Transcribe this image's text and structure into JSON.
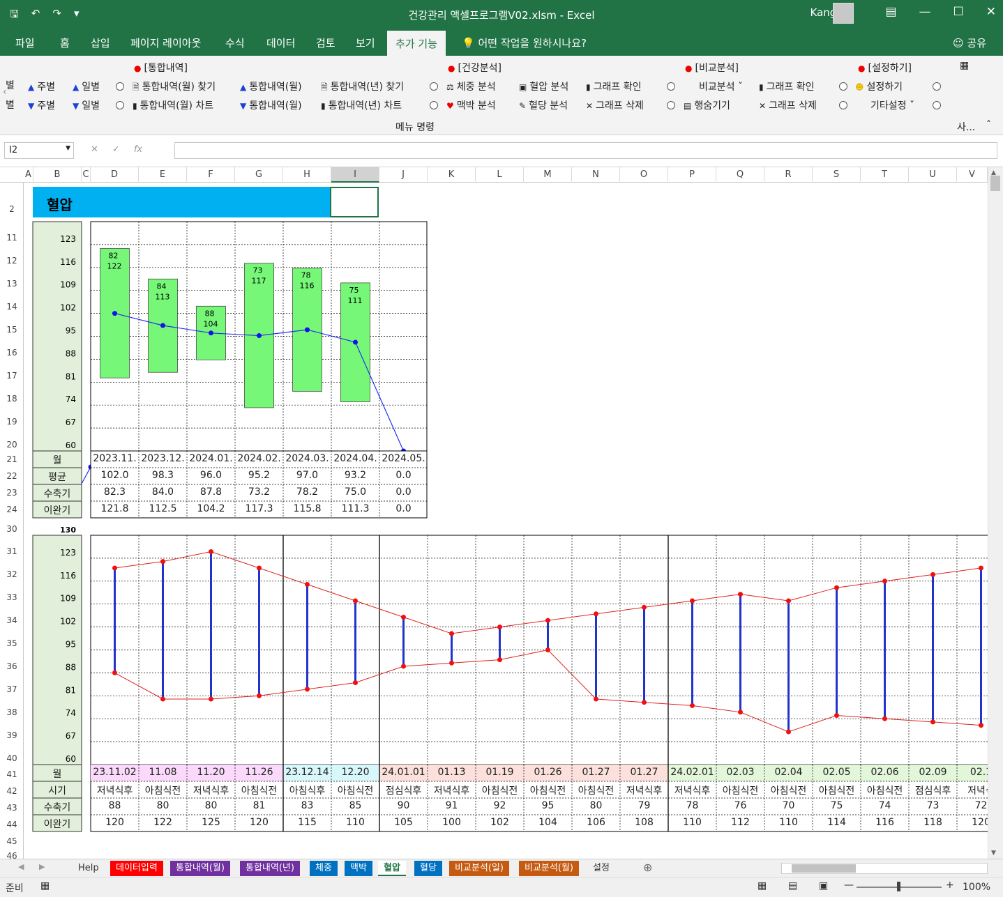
{
  "titlebar": {
    "title": "건강관리 액셀프로그램V02.xlsm  -  Excel",
    "user": "Kangha"
  },
  "tabs": [
    "파일",
    "홈",
    "삽입",
    "페이지 레이아웃",
    "수식",
    "데이터",
    "검토",
    "보기",
    "추가 기능"
  ],
  "tellme": "어떤 작업을 원하시나요?",
  "share": "공유",
  "ribbon": {
    "groups": {
      "integrated": "[통합내역]",
      "health": "[건강분석]",
      "compare": "[비교분석]",
      "settings": "[설정하기]"
    },
    "weekly": "주별",
    "daily": "일별",
    "find_month": "통합내역(월) 찾기",
    "chart_month": "통합내역(월) 차트",
    "int_month": "통합내역(월)",
    "find_year": "통합내역(년) 찾기",
    "chart_year": "통합내역(년) 차트",
    "weight": "체중 분석",
    "pulse": "맥박 분석",
    "bp": "혈압 분석",
    "sugar": "혈당 분석",
    "graph_check": "그래프 확인",
    "graph_delete": "그래프 삭제",
    "compare": "비교분석",
    "hide_rows": "행숨기기",
    "setup": "설정하기",
    "other_setup": "기타설정",
    "menu_cmd": "메뉴 명령",
    "more": "사..."
  },
  "namebox": "I2",
  "columns": [
    "A",
    "B",
    "C",
    "D",
    "E",
    "F",
    "G",
    "H",
    "I",
    "J",
    "K",
    "L",
    "M",
    "N",
    "O",
    "P",
    "Q",
    "R",
    "S",
    "T",
    "U",
    "V"
  ],
  "rows": {
    "r2": "2",
    "upper": [
      "11",
      "12",
      "13",
      "14",
      "15",
      "16",
      "17",
      "18",
      "19",
      "20",
      "21",
      "22",
      "23",
      "24"
    ],
    "lower": [
      "30",
      "31",
      "32",
      "33",
      "34",
      "35",
      "36",
      "37",
      "38",
      "39",
      "40",
      "41",
      "42",
      "43",
      "44",
      "45",
      "46"
    ]
  },
  "banner": "혈압",
  "upper": {
    "yticks": [
      "123",
      "116",
      "109",
      "102",
      "95",
      "88",
      "81",
      "74",
      "67",
      "60"
    ],
    "row_labels": [
      "월",
      "평균",
      "수축기",
      "이완기"
    ],
    "months": [
      "2023.11.",
      "2023.12.",
      "2024.01.",
      "2024.02.",
      "2024.03.",
      "2024.04.",
      "2024.05."
    ],
    "avg": [
      "102.0",
      "98.3",
      "96.0",
      "95.2",
      "97.0",
      "93.2",
      "0.0"
    ],
    "sys": [
      "82.3",
      "84.0",
      "87.8",
      "73.2",
      "78.2",
      "75.0",
      "0.0"
    ],
    "dia": [
      "121.8",
      "112.5",
      "104.2",
      "117.3",
      "115.8",
      "111.3",
      "0.0"
    ],
    "bar_labels": [
      [
        "82",
        "122"
      ],
      [
        "84",
        "113"
      ],
      [
        "88",
        "104"
      ],
      [
        "73",
        "117"
      ],
      [
        "78",
        "116"
      ],
      [
        "75",
        "111"
      ]
    ]
  },
  "lower": {
    "ytop": "130",
    "yticks": [
      "123",
      "116",
      "109",
      "102",
      "95",
      "88",
      "81",
      "74",
      "67",
      "60"
    ],
    "row_labels": [
      "월",
      "시기",
      "수축기",
      "이완기"
    ],
    "dates": [
      "23.11.02",
      "11.08",
      "11.20",
      "11.26",
      "23.12.14",
      "12.20",
      "24.01.01",
      "01.13",
      "01.19",
      "01.26",
      "01.27",
      "01.27",
      "24.02.01",
      "02.03",
      "02.04",
      "02.05",
      "02.06",
      "02.09",
      "02.1"
    ],
    "times": [
      "저녁식후",
      "아침식전",
      "저녁식후",
      "아침식전",
      "아침식후",
      "아침식전",
      "점심식후",
      "저녁식후",
      "아침식전",
      "아침식전",
      "아침식전",
      "저녁식후",
      "저녁식후",
      "아침식전",
      "아침식전",
      "아침식전",
      "아침식전",
      "점심식후",
      "저녁식"
    ],
    "sys": [
      "88",
      "80",
      "80",
      "81",
      "83",
      "85",
      "90",
      "91",
      "92",
      "95",
      "80",
      "79",
      "78",
      "76",
      "70",
      "75",
      "74",
      "73",
      "72"
    ],
    "dia": [
      "120",
      "122",
      "125",
      "120",
      "115",
      "110",
      "105",
      "100",
      "102",
      "104",
      "106",
      "108",
      "110",
      "112",
      "110",
      "114",
      "116",
      "118",
      "120"
    ],
    "date_colors": [
      "#fbd9fb",
      "#fbd9fb",
      "#fbd9fb",
      "#fbd9fb",
      "#d7f7fb",
      "#d7f7fb",
      "#fbe0dc",
      "#fbe0dc",
      "#fbe0dc",
      "#fbe0dc",
      "#fbe0dc",
      "#fbe0dc",
      "#e2f6d9",
      "#e2f6d9",
      "#e2f6d9",
      "#e2f6d9",
      "#e2f6d9",
      "#e2f6d9",
      "#e2f6d9"
    ]
  },
  "chart_data": [
    {
      "type": "bar",
      "categories": [
        "2023.11.",
        "2023.12.",
        "2024.01.",
        "2024.02.",
        "2024.03.",
        "2024.04.",
        "2024.05."
      ],
      "series": [
        {
          "values": [
            82.3,
            84.0,
            87.8,
            73.2,
            78.2,
            75.0,
            0.0
          ]
        },
        {
          "values": [
            121.8,
            112.5,
            104.2,
            117.3,
            115.8,
            111.3,
            0.0
          ]
        },
        {
          "values": [
            102.0,
            98.3,
            96.0,
            95.2,
            97.0,
            93.2,
            0.0
          ]
        }
      ],
      "ylim": [
        60,
        130
      ]
    },
    {
      "type": "line",
      "categories": [
        "23.11.02",
        "11.08",
        "11.20",
        "11.26",
        "23.12.14",
        "12.20",
        "24.01.01",
        "01.13",
        "01.19",
        "01.26",
        "01.27",
        "01.27",
        "24.02.01",
        "02.03",
        "02.04",
        "02.05",
        "02.06",
        "02.09",
        "02.1"
      ],
      "series": [
        {
          "values": [
            88,
            80,
            80,
            81,
            83,
            85,
            90,
            91,
            92,
            95,
            80,
            79,
            78,
            76,
            70,
            75,
            74,
            73,
            72
          ]
        },
        {
          "values": [
            120,
            122,
            125,
            120,
            115,
            110,
            105,
            100,
            102,
            104,
            106,
            108,
            110,
            112,
            110,
            114,
            116,
            118,
            120
          ]
        }
      ],
      "ylim": [
        60,
        130
      ]
    }
  ],
  "sheettabs": [
    {
      "label": "Help",
      "color": "#f0f0f0",
      "fg": "#333"
    },
    {
      "label": "데이터입력",
      "color": "#ff0000",
      "fg": "#fff"
    },
    {
      "label": "통합내역(월)",
      "color": "#7030a0",
      "fg": "#fff"
    },
    {
      "label": "통합내역(년)",
      "color": "#7030a0",
      "fg": "#fff"
    },
    {
      "label": "체중",
      "color": "#0070c0",
      "fg": "#fff"
    },
    {
      "label": "맥박",
      "color": "#0070c0",
      "fg": "#fff"
    },
    {
      "label": "혈압",
      "color": "#ffffff",
      "fg": "#217346"
    },
    {
      "label": "혈당",
      "color": "#0070c0",
      "fg": "#fff"
    },
    {
      "label": "비교분석(일)",
      "color": "#c55a11",
      "fg": "#fff"
    },
    {
      "label": "비교분석(월)",
      "color": "#c55a11",
      "fg": "#fff"
    },
    {
      "label": "설정",
      "color": "#f0f0f0",
      "fg": "#333"
    }
  ],
  "status": {
    "ready": "준비",
    "zoom": "100%"
  }
}
